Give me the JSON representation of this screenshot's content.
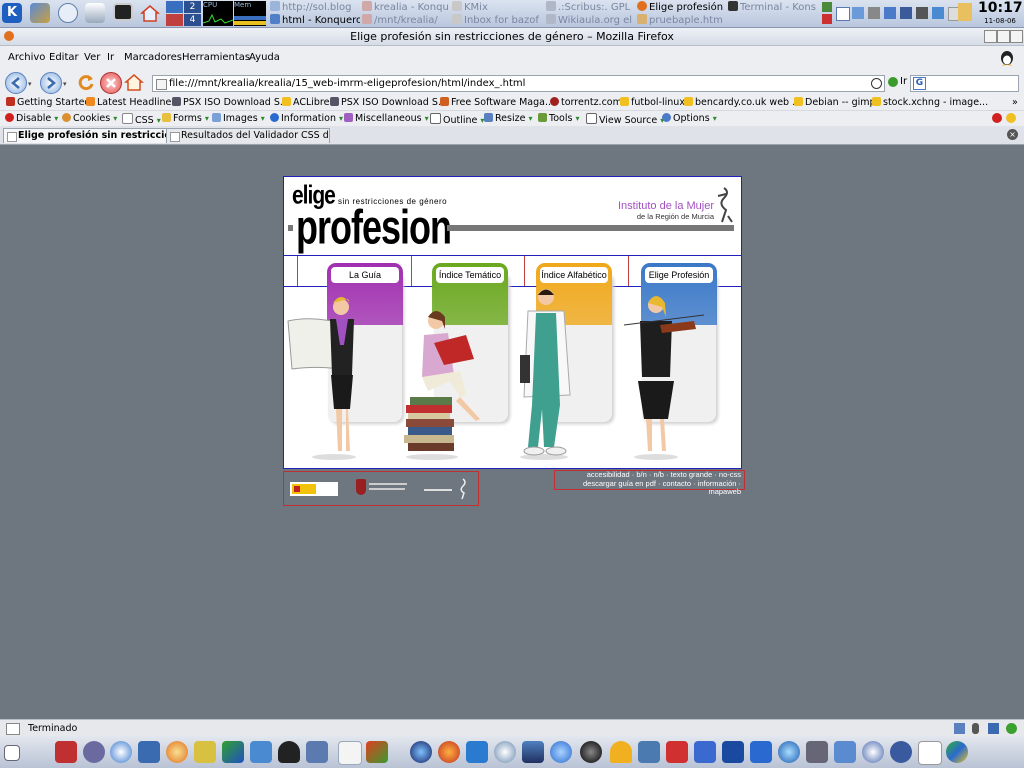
{
  "top_panel": {
    "desktop_numbers": [
      "2",
      "4"
    ],
    "cpu_label": "CPU",
    "mem_label": "Mem",
    "tasks": [
      {
        "label": "http://sol.blog",
        "active": false
      },
      {
        "label": "krealia - Konque",
        "active": false
      },
      {
        "label": "KMix",
        "active": false
      },
      {
        "label": ".:Scribus:. GPL",
        "active": false
      },
      {
        "label": "Elige profesión",
        "active": true
      },
      {
        "label": "Terminal - Kons",
        "active": false
      },
      {
        "label": "html - Konqueror",
        "active": true
      },
      {
        "label": "/mnt/krealia/",
        "active": false
      },
      {
        "label": "Inbox for bazof",
        "active": false
      },
      {
        "label": "Wikiaula.org el",
        "active": false
      },
      {
        "label": "pruebaple.htm",
        "active": false
      }
    ],
    "clock_time": "10:17",
    "clock_date": "11-08-06"
  },
  "window": {
    "title": "Elige profesión sin restricciones de género – Mozilla Firefox"
  },
  "menubar": {
    "items": [
      "Archivo",
      "Editar",
      "Ver",
      "Ir",
      "Marcadores",
      "Herramientas",
      "Ayuda"
    ]
  },
  "navbar": {
    "url": "file:///mnt/krealia/krealia/15_web-imrm-eligeprofesion/html/index_.html",
    "go_label": "Ir",
    "search_engine_letter": "G"
  },
  "bookmarks": [
    "Getting Started",
    "Latest Headlines",
    "PSX ISO Download S...",
    "ACLibre",
    "PSX ISO Download S...",
    "Free Software Maga...",
    "torrentz.com",
    "futbol-linux",
    "bencardy.co.uk web ...",
    "Debian -- gimp",
    "stock.xchng - image..."
  ],
  "devbar": [
    "Disable",
    "Cookies",
    "CSS",
    "Forms",
    "Images",
    "Information",
    "Miscellaneous",
    "Outline",
    "Resize",
    "Tools",
    "View Source",
    "Options"
  ],
  "tabs": [
    {
      "label": "Elige profesión sin restriccio...",
      "selected": true
    },
    {
      "label": "Resultados del Validador CSS de...",
      "selected": false
    }
  ],
  "site": {
    "logo_top": "elige",
    "logo_sub": "sin restricciones de género",
    "logo_main": "profesion",
    "institute_name": "Instituto de la Mujer",
    "institute_region": "de la Región de Murcia",
    "nav": [
      {
        "label": "La Guía",
        "color": "#a02fb0"
      },
      {
        "label": "Índice Temático",
        "color": "#6aa81e"
      },
      {
        "label": "Índice Alfabético",
        "color": "#f0a81a"
      },
      {
        "label": "Elige Profesión",
        "color": "#3a78c8"
      }
    ],
    "footer_links_line1": "accesibilidad · b/n · n/b · texto grande · no-css",
    "footer_links_line2": "descargar guía en pdf · contacto · información · mapaweb"
  },
  "statusbar": {
    "text": "Terminado"
  },
  "colors": {
    "desktop_gray": "#6e7680",
    "site_border": "#2222bb",
    "institute_purple": "#a24fc0"
  }
}
